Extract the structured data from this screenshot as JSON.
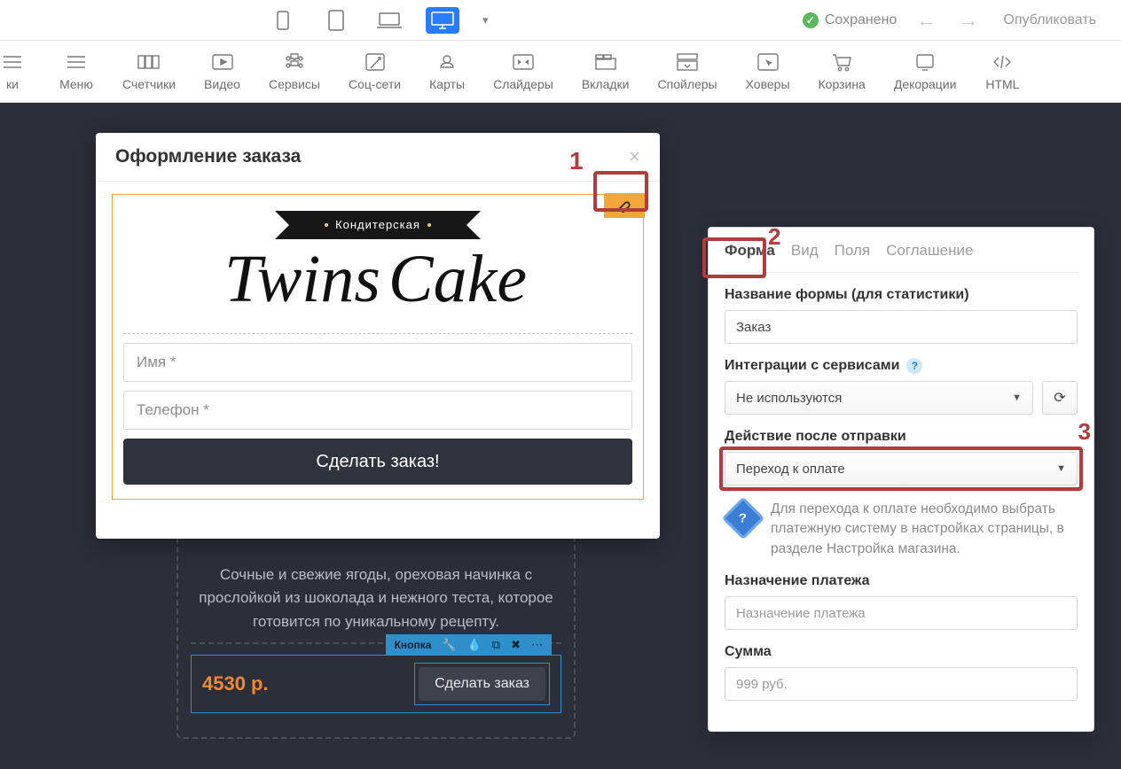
{
  "topbar": {
    "saved_label": "Сохранено",
    "publish_label": "Опубликовать"
  },
  "tools": [
    {
      "label": "ки"
    },
    {
      "label": "Меню"
    },
    {
      "label": "Счетчики"
    },
    {
      "label": "Видео"
    },
    {
      "label": "Сервисы"
    },
    {
      "label": "Соц-сети"
    },
    {
      "label": "Карты"
    },
    {
      "label": "Слайдеры"
    },
    {
      "label": "Вкладки"
    },
    {
      "label": "Спойлеры"
    },
    {
      "label": "Ховеры"
    },
    {
      "label": "Корзина"
    },
    {
      "label": "Декорации"
    },
    {
      "label": "HTML"
    }
  ],
  "bgcard": {
    "text": "Сочные и свежие ягоды, ореховая начинка с прослойкой из шоколада и нежного теста, которое готовится по уникальному рецепту.",
    "price": "4530 р.",
    "element_label": "Кнопка",
    "button_label": "Сделать заказ"
  },
  "order": {
    "title": "Оформление заказа",
    "ribbon": "Кондитерская",
    "brand_top": "Twins",
    "brand_bottom": "Cake",
    "name_placeholder": "Имя *",
    "phone_placeholder": "Телефон *",
    "submit_label": "Сделать заказ!"
  },
  "markers": {
    "one": "1",
    "two": "2",
    "three": "3"
  },
  "settings": {
    "tabs": {
      "form": "Форма",
      "view": "Вид",
      "fields": "Поля",
      "agreement": "Соглашение"
    },
    "name_label": "Название формы (для статистики)",
    "name_value": "Заказ",
    "integrations_label": "Интеграции с сервисами",
    "integrations_value": "Не используются",
    "action_label": "Действие после отправки",
    "action_value": "Переход к оплате",
    "info_text": "Для перехода к оплате необходимо выбрать платежную систему в настройках страницы, в разделе Настройка магазина.",
    "purpose_label": "Назначение платежа",
    "purpose_placeholder": "Назначение платежа",
    "amount_label": "Сумма",
    "amount_placeholder": "999 руб."
  }
}
